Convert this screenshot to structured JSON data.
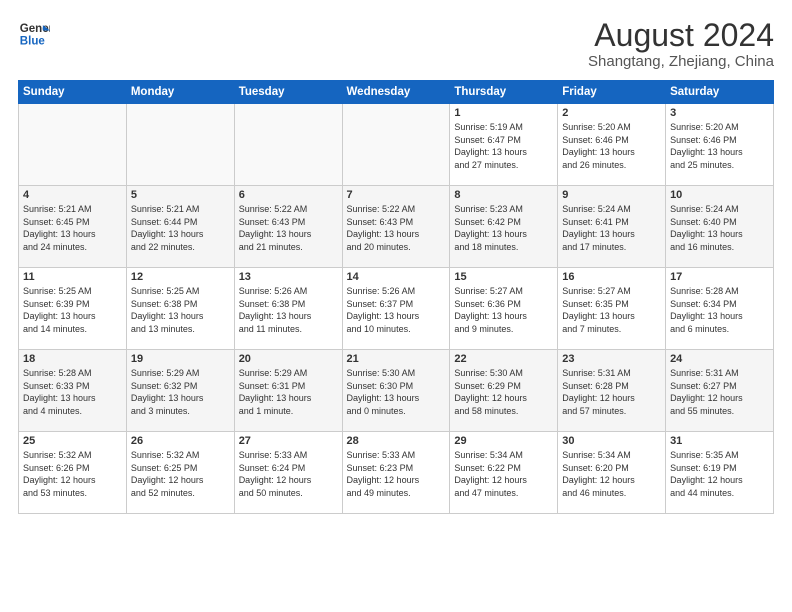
{
  "logo": {
    "line1": "General",
    "line2": "Blue"
  },
  "title": "August 2024",
  "location": "Shangtang, Zhejiang, China",
  "weekdays": [
    "Sunday",
    "Monday",
    "Tuesday",
    "Wednesday",
    "Thursday",
    "Friday",
    "Saturday"
  ],
  "weeks": [
    [
      {
        "day": "",
        "info": ""
      },
      {
        "day": "",
        "info": ""
      },
      {
        "day": "",
        "info": ""
      },
      {
        "day": "",
        "info": ""
      },
      {
        "day": "1",
        "info": "Sunrise: 5:19 AM\nSunset: 6:47 PM\nDaylight: 13 hours\nand 27 minutes."
      },
      {
        "day": "2",
        "info": "Sunrise: 5:20 AM\nSunset: 6:46 PM\nDaylight: 13 hours\nand 26 minutes."
      },
      {
        "day": "3",
        "info": "Sunrise: 5:20 AM\nSunset: 6:46 PM\nDaylight: 13 hours\nand 25 minutes."
      }
    ],
    [
      {
        "day": "4",
        "info": "Sunrise: 5:21 AM\nSunset: 6:45 PM\nDaylight: 13 hours\nand 24 minutes."
      },
      {
        "day": "5",
        "info": "Sunrise: 5:21 AM\nSunset: 6:44 PM\nDaylight: 13 hours\nand 22 minutes."
      },
      {
        "day": "6",
        "info": "Sunrise: 5:22 AM\nSunset: 6:43 PM\nDaylight: 13 hours\nand 21 minutes."
      },
      {
        "day": "7",
        "info": "Sunrise: 5:22 AM\nSunset: 6:43 PM\nDaylight: 13 hours\nand 20 minutes."
      },
      {
        "day": "8",
        "info": "Sunrise: 5:23 AM\nSunset: 6:42 PM\nDaylight: 13 hours\nand 18 minutes."
      },
      {
        "day": "9",
        "info": "Sunrise: 5:24 AM\nSunset: 6:41 PM\nDaylight: 13 hours\nand 17 minutes."
      },
      {
        "day": "10",
        "info": "Sunrise: 5:24 AM\nSunset: 6:40 PM\nDaylight: 13 hours\nand 16 minutes."
      }
    ],
    [
      {
        "day": "11",
        "info": "Sunrise: 5:25 AM\nSunset: 6:39 PM\nDaylight: 13 hours\nand 14 minutes."
      },
      {
        "day": "12",
        "info": "Sunrise: 5:25 AM\nSunset: 6:38 PM\nDaylight: 13 hours\nand 13 minutes."
      },
      {
        "day": "13",
        "info": "Sunrise: 5:26 AM\nSunset: 6:38 PM\nDaylight: 13 hours\nand 11 minutes."
      },
      {
        "day": "14",
        "info": "Sunrise: 5:26 AM\nSunset: 6:37 PM\nDaylight: 13 hours\nand 10 minutes."
      },
      {
        "day": "15",
        "info": "Sunrise: 5:27 AM\nSunset: 6:36 PM\nDaylight: 13 hours\nand 9 minutes."
      },
      {
        "day": "16",
        "info": "Sunrise: 5:27 AM\nSunset: 6:35 PM\nDaylight: 13 hours\nand 7 minutes."
      },
      {
        "day": "17",
        "info": "Sunrise: 5:28 AM\nSunset: 6:34 PM\nDaylight: 13 hours\nand 6 minutes."
      }
    ],
    [
      {
        "day": "18",
        "info": "Sunrise: 5:28 AM\nSunset: 6:33 PM\nDaylight: 13 hours\nand 4 minutes."
      },
      {
        "day": "19",
        "info": "Sunrise: 5:29 AM\nSunset: 6:32 PM\nDaylight: 13 hours\nand 3 minutes."
      },
      {
        "day": "20",
        "info": "Sunrise: 5:29 AM\nSunset: 6:31 PM\nDaylight: 13 hours\nand 1 minute."
      },
      {
        "day": "21",
        "info": "Sunrise: 5:30 AM\nSunset: 6:30 PM\nDaylight: 13 hours\nand 0 minutes."
      },
      {
        "day": "22",
        "info": "Sunrise: 5:30 AM\nSunset: 6:29 PM\nDaylight: 12 hours\nand 58 minutes."
      },
      {
        "day": "23",
        "info": "Sunrise: 5:31 AM\nSunset: 6:28 PM\nDaylight: 12 hours\nand 57 minutes."
      },
      {
        "day": "24",
        "info": "Sunrise: 5:31 AM\nSunset: 6:27 PM\nDaylight: 12 hours\nand 55 minutes."
      }
    ],
    [
      {
        "day": "25",
        "info": "Sunrise: 5:32 AM\nSunset: 6:26 PM\nDaylight: 12 hours\nand 53 minutes."
      },
      {
        "day": "26",
        "info": "Sunrise: 5:32 AM\nSunset: 6:25 PM\nDaylight: 12 hours\nand 52 minutes."
      },
      {
        "day": "27",
        "info": "Sunrise: 5:33 AM\nSunset: 6:24 PM\nDaylight: 12 hours\nand 50 minutes."
      },
      {
        "day": "28",
        "info": "Sunrise: 5:33 AM\nSunset: 6:23 PM\nDaylight: 12 hours\nand 49 minutes."
      },
      {
        "day": "29",
        "info": "Sunrise: 5:34 AM\nSunset: 6:22 PM\nDaylight: 12 hours\nand 47 minutes."
      },
      {
        "day": "30",
        "info": "Sunrise: 5:34 AM\nSunset: 6:20 PM\nDaylight: 12 hours\nand 46 minutes."
      },
      {
        "day": "31",
        "info": "Sunrise: 5:35 AM\nSunset: 6:19 PM\nDaylight: 12 hours\nand 44 minutes."
      }
    ]
  ]
}
